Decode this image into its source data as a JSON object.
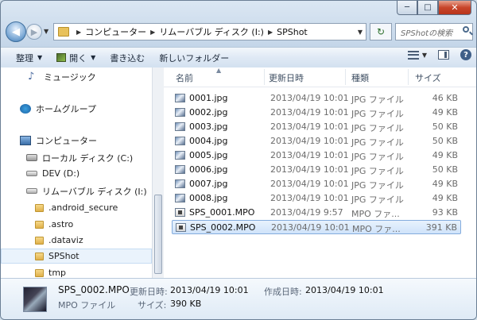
{
  "window": {
    "caption_buttons": {
      "minimize": "─",
      "maximize": "□",
      "close": "✕"
    }
  },
  "address_bar": {
    "breadcrumbs": [
      "コンピューター",
      "リムーバブル ディスク (I:)",
      "SPShot"
    ],
    "search_placeholder": "SPShotの検索"
  },
  "toolbar": {
    "organize": "整理",
    "open": "開く",
    "burn": "書き込む",
    "new_folder": "新しいフォルダー"
  },
  "nav_pane": {
    "items": [
      {
        "label": "ミュージック",
        "icon": "music-icon"
      },
      {
        "label": "ホームグループ",
        "icon": "homegroup-icon"
      },
      {
        "label": "コンピューター",
        "icon": "computer-icon"
      },
      {
        "label": "ローカル ディスク (C:)",
        "icon": "local-disk-icon"
      },
      {
        "label": "DEV (D:)",
        "icon": "drive-icon"
      },
      {
        "label": "リムーバブル ディスク (I:)",
        "icon": "removable-disk-icon"
      },
      {
        "label": ".android_secure",
        "icon": "folder-icon"
      },
      {
        "label": ".astro",
        "icon": "folder-icon"
      },
      {
        "label": ".dataviz",
        "icon": "folder-icon"
      },
      {
        "label": "SPShot",
        "icon": "folder-icon",
        "selected": true
      },
      {
        "label": "tmp",
        "icon": "folder-icon"
      }
    ]
  },
  "file_list": {
    "columns": {
      "name": "名前",
      "date": "更新日時",
      "type": "種類",
      "size": "サイズ"
    },
    "rows": [
      {
        "name": "0001.jpg",
        "date": "2013/04/19 10:01",
        "type": "JPG ファイル",
        "size": "46 KB"
      },
      {
        "name": "0002.jpg",
        "date": "2013/04/19 10:01",
        "type": "JPG ファイル",
        "size": "49 KB"
      },
      {
        "name": "0003.jpg",
        "date": "2013/04/19 10:01",
        "type": "JPG ファイル",
        "size": "50 KB"
      },
      {
        "name": "0004.jpg",
        "date": "2013/04/19 10:01",
        "type": "JPG ファイル",
        "size": "50 KB"
      },
      {
        "name": "0005.jpg",
        "date": "2013/04/19 10:01",
        "type": "JPG ファイル",
        "size": "49 KB"
      },
      {
        "name": "0006.jpg",
        "date": "2013/04/19 10:01",
        "type": "JPG ファイル",
        "size": "50 KB"
      },
      {
        "name": "0007.jpg",
        "date": "2013/04/19 10:01",
        "type": "JPG ファイル",
        "size": "49 KB"
      },
      {
        "name": "0008.jpg",
        "date": "2013/04/19 10:01",
        "type": "JPG ファイル",
        "size": "49 KB"
      },
      {
        "name": "SPS_0001.MPO",
        "date": "2013/04/19 9:57",
        "type": "MPO ファ...",
        "size": "93 KB"
      },
      {
        "name": "SPS_0002.MPO",
        "date": "2013/04/19 10:01",
        "type": "MPO ファ...",
        "size": "391 KB",
        "selected": true
      }
    ]
  },
  "details": {
    "name": "SPS_0002.MPO",
    "type": "MPO ファイル",
    "modified_label": "更新日時:",
    "modified_value": "2013/04/19 10:01",
    "created_label": "作成日時:",
    "created_value": "2013/04/19 10:01",
    "size_label": "サイズ:",
    "size_value": "390 KB"
  }
}
